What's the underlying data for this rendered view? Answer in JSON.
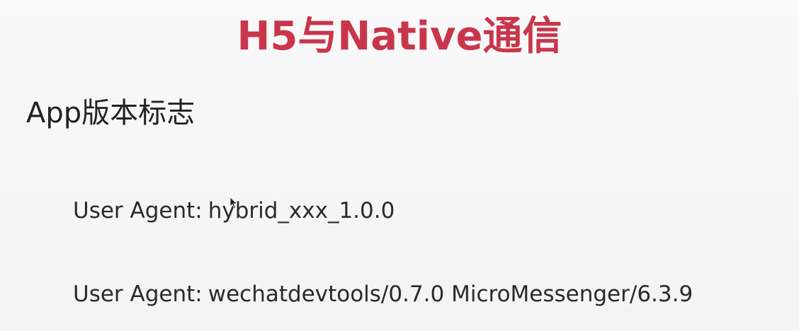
{
  "slide": {
    "title": "H5与Native通信",
    "subtitle": "App版本标志",
    "user_agents": [
      {
        "label": "User Agent:",
        "value": "hybrid_xxx_1.0.0"
      },
      {
        "label": "User Agent:",
        "value": "wechatdevtools/0.7.0 MicroMessenger/6.3.9"
      }
    ]
  },
  "colors": {
    "title": "#c9364b",
    "text": "#2a2a2a",
    "background": "#f6f6f6"
  },
  "icons": {
    "cursor": "mouse-pointer-icon"
  }
}
